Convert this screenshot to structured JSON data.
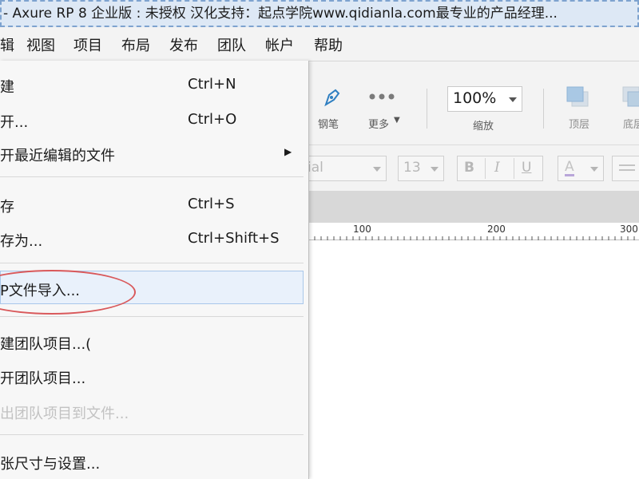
{
  "window": {
    "title": "- Axure RP 8 企业版 : 未授权 汉化支持：起点学院www.qidianla.com最专业的产品经理..."
  },
  "menubar": {
    "items": [
      "辑",
      "视图",
      "项目",
      "布局",
      "发布",
      "团队",
      "帐户",
      "帮助"
    ]
  },
  "toolbar": {
    "pen_label": "钢笔",
    "more_label": "更多",
    "zoom_value": "100%",
    "zoom_label": "缩放",
    "top_label": "顶层",
    "bottom_label": "底层"
  },
  "formatbar": {
    "font_name": "ial",
    "font_size": "13",
    "bold": "B",
    "italic": "I",
    "underline": "U",
    "font_color": "A"
  },
  "ruler": {
    "labels": [
      "100",
      "200",
      "300"
    ]
  },
  "file_menu": {
    "items": [
      {
        "label": "建",
        "shortcut": "Ctrl+N"
      },
      {
        "label": "开...",
        "shortcut": "Ctrl+O"
      },
      {
        "label": "开最近编辑的文件",
        "shortcut": ""
      },
      {
        "label": "存",
        "shortcut": "Ctrl+S"
      },
      {
        "label": "存为...",
        "shortcut": "Ctrl+Shift+S"
      },
      {
        "label": "P文件导入...",
        "shortcut": ""
      },
      {
        "label": "建团队项目...(",
        "shortcut": ""
      },
      {
        "label": "开团队项目...",
        "shortcut": ""
      },
      {
        "label": "出团队项目到文件...",
        "shortcut": ""
      },
      {
        "label": "张尺寸与设置...",
        "shortcut": ""
      }
    ]
  },
  "colors": {
    "highlight_border": "#a9c7ea",
    "annotation_circle": "#d9595b",
    "title_border": "#7ea3cf"
  }
}
